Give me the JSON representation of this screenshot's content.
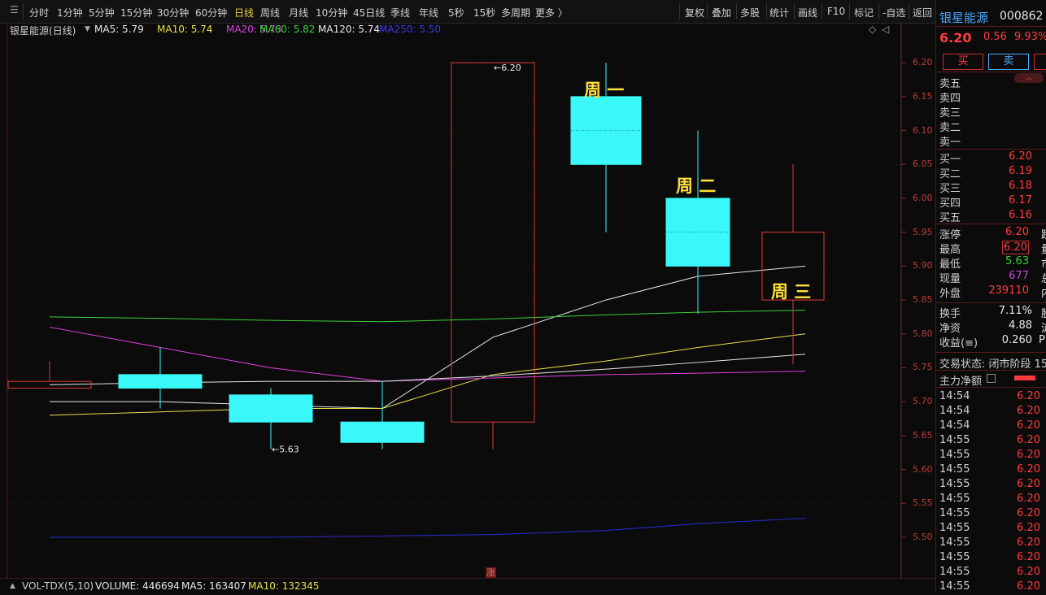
{
  "toolbar": {
    "periods": [
      "分时",
      "1分钟",
      "5分钟",
      "15分钟",
      "30分钟",
      "60分钟",
      "日线",
      "周线",
      "月线",
      "10分钟",
      "45日线",
      "季线",
      "年线",
      "5秒",
      "15秒",
      "多周期",
      "更多 〉"
    ],
    "active_period": "日线",
    "controls": [
      "复权",
      "叠加",
      "多股",
      "统计",
      "画线",
      "F10",
      "标记",
      "-自选",
      "返回"
    ]
  },
  "ma_legend": {
    "title": "银星能源(日线)",
    "ma5": "MA5: 5.79",
    "ma10": "MA10: 5.74",
    "ma20": "MA20: 5.73",
    "ma60": "MA60: 5.82",
    "ma120": "MA120: 5.74",
    "ma250": "MA250: 5.50"
  },
  "colors": {
    "ma5": "#e8e8e8",
    "ma10": "#e8e04a",
    "ma20": "#e040e0",
    "ma60": "#3bd13b",
    "ma120": "#e8e8e8",
    "ma250": "#2a2ad8",
    "up": "#e03a3a",
    "down": "#3af8f8",
    "label": "#ffe03a"
  },
  "chart_data": {
    "type": "candlestick",
    "y_ticks": [
      "6.20",
      "6.15",
      "6.10",
      "6.05",
      "6.00",
      "5.95",
      "5.90",
      "5.85",
      "5.80",
      "5.75",
      "5.70",
      "5.65",
      "5.60",
      "5.55",
      "5.50"
    ],
    "ylim": [
      5.47,
      6.235
    ],
    "candles": [
      {
        "open": 5.73,
        "close": 5.72,
        "high": 5.76,
        "low": 5.72,
        "dir": "up"
      },
      {
        "open": 5.74,
        "close": 5.72,
        "high": 5.78,
        "low": 5.69,
        "dir": "down"
      },
      {
        "open": 5.71,
        "close": 5.67,
        "high": 5.72,
        "low": 5.63,
        "dir": "down"
      },
      {
        "open": 5.67,
        "close": 5.64,
        "high": 5.73,
        "low": 5.63,
        "dir": "down"
      },
      {
        "open": 5.67,
        "close": 6.2,
        "high": 6.2,
        "low": 5.63,
        "dir": "up"
      },
      {
        "open": 6.15,
        "close": 6.05,
        "high": 6.2,
        "low": 5.95,
        "dir": "down"
      },
      {
        "open": 6.0,
        "close": 5.9,
        "high": 6.1,
        "low": 5.83,
        "dir": "down"
      },
      {
        "open": 5.85,
        "close": 5.95,
        "high": 6.05,
        "low": 5.755,
        "dir": "up"
      }
    ],
    "ma_series": [
      {
        "name": "MA5",
        "values": [
          5.7,
          5.7,
          5.695,
          5.69,
          5.795,
          5.85,
          5.885,
          5.9
        ],
        "visible_from": 0
      },
      {
        "name": "MA10",
        "values": [
          5.68,
          5.685,
          5.69,
          5.69,
          5.74,
          5.76,
          5.78,
          5.8
        ],
        "visible_from": 0
      },
      {
        "name": "MA20",
        "values": [
          5.81,
          5.78,
          5.75,
          5.73,
          5.735,
          5.74,
          5.742,
          5.745
        ],
        "visible_from": 0
      },
      {
        "name": "MA60",
        "values": [
          5.825,
          5.823,
          5.82,
          5.818,
          5.822,
          5.828,
          5.832,
          5.835
        ],
        "visible_from": 0
      },
      {
        "name": "MA120",
        "values": [
          5.725,
          5.728,
          5.73,
          5.73,
          5.738,
          5.748,
          5.758,
          5.77
        ],
        "visible_from": 0
      },
      {
        "name": "MA250",
        "values": [
          5.5,
          5.5,
          5.5,
          5.502,
          5.504,
          5.51,
          5.52,
          5.528
        ],
        "visible_from": 0
      }
    ],
    "annotations": [
      {
        "text": "6.20",
        "candle": 4,
        "price": 6.2,
        "arrow": "←"
      },
      {
        "text": "5.63",
        "candle": 2,
        "price": 5.63,
        "arrow": "←"
      }
    ],
    "week_labels": [
      {
        "text": "周 一",
        "candle": 5,
        "price": 6.162
      },
      {
        "text": "周 二",
        "candle": 6,
        "price": 6.02
      },
      {
        "text": "周 三",
        "candle": 7,
        "price": 5.865
      }
    ],
    "rise_marker": "涨"
  },
  "volume_bar": {
    "label": "VOL-TDX(5,10)",
    "volume": "VOLUME: 446694",
    "ma5": "MA5: 163407",
    "ma10": "MA10: 132345"
  },
  "right_panel": {
    "stock_name": "银星能源",
    "stock_code": "000862",
    "price": "6.20",
    "change": "0.56",
    "change_pct": "9.93%",
    "buy_label": "买",
    "sell_label": "卖",
    "sell_levels": [
      {
        "label": "卖五",
        "price": ""
      },
      {
        "label": "卖四",
        "price": ""
      },
      {
        "label": "卖三",
        "price": ""
      },
      {
        "label": "卖二",
        "price": ""
      },
      {
        "label": "卖一",
        "price": ""
      }
    ],
    "buy_levels": [
      {
        "label": "买一",
        "price": "6.20"
      },
      {
        "label": "买二",
        "price": "6.19"
      },
      {
        "label": "买三",
        "price": "6.18"
      },
      {
        "label": "买四",
        "price": "6.17"
      },
      {
        "label": "买五",
        "price": "6.16"
      }
    ],
    "stats": [
      {
        "label": "涨停",
        "value": "6.20",
        "extra": "跌",
        "color": "red"
      },
      {
        "label": "最高",
        "value": "6.20",
        "extra": "量",
        "color": "red",
        "boxed": true
      },
      {
        "label": "最低",
        "value": "5.63",
        "extra": "市",
        "color": "green"
      },
      {
        "label": "现量",
        "value": "677",
        "extra": "总",
        "color": "purple"
      },
      {
        "label": "外盘",
        "value": "239110",
        "extra": "内",
        "color": "red"
      }
    ],
    "stats2": [
      {
        "label": "换手",
        "value": "7.11%",
        "extra": "股"
      },
      {
        "label": "净资",
        "value": "4.88",
        "extra": "流"
      },
      {
        "label": "收益(≡)",
        "value": "0.260",
        "extra": "PE"
      }
    ],
    "trade_status": "交易状态: 闭市阶段 15",
    "main_flow_label": "主力净额",
    "ticks": [
      {
        "time": "14:54",
        "price": "6.20"
      },
      {
        "time": "14:54",
        "price": "6.20"
      },
      {
        "time": "14:54",
        "price": "6.20"
      },
      {
        "time": "14:55",
        "price": "6.20"
      },
      {
        "time": "14:55",
        "price": "6.20"
      },
      {
        "time": "14:55",
        "price": "6.20"
      },
      {
        "time": "14:55",
        "price": "6.20"
      },
      {
        "time": "14:55",
        "price": "6.20"
      },
      {
        "time": "14:55",
        "price": "6.20"
      },
      {
        "time": "14:55",
        "price": "6.20"
      },
      {
        "time": "14:55",
        "price": "6.20"
      },
      {
        "time": "14:55",
        "price": "6.20"
      },
      {
        "time": "14:55",
        "price": "6.20"
      },
      {
        "time": "14:55",
        "price": "6.20"
      }
    ]
  }
}
